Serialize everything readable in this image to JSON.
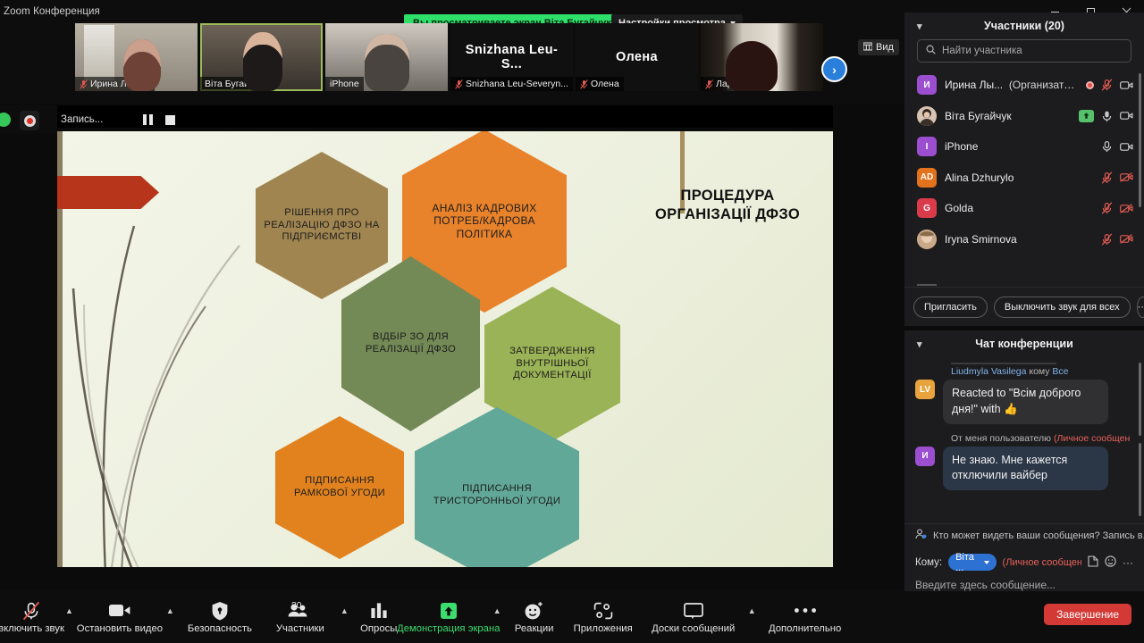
{
  "window": {
    "title": "Zoom Конференция",
    "controls": {
      "minimize": "–",
      "maximize": "❐",
      "close": "✕"
    }
  },
  "share_banner": {
    "notice": "Вы просматриваете экран Віта Бугайчук",
    "view_options": "Настройки просмотра"
  },
  "filmstrip": {
    "view_button": "Вид",
    "next_arrow": "›",
    "tiles": [
      {
        "name": "Ирина Лылык",
        "muted": true,
        "big": "",
        "photo": "ph-irina",
        "speaking": false
      },
      {
        "name": "Віта Бугайчук",
        "muted": false,
        "big": "",
        "photo": "ph-vita",
        "speaking": true
      },
      {
        "name": "iPhone",
        "muted": false,
        "big": "",
        "photo": "ph-iphone",
        "speaking": false
      },
      {
        "name": "Snizhana Leu-Severyn...",
        "muted": true,
        "big": "Snizhana  Leu-S...",
        "photo": "ph-dark",
        "speaking": false
      },
      {
        "name": "Олена",
        "muted": true,
        "big": "Олена",
        "photo": "ph-dark",
        "speaking": false
      },
      {
        "name": "Лариса",
        "muted": true,
        "big": "",
        "photo": "ph-larisa",
        "speaking": false
      }
    ]
  },
  "recording_bar": {
    "label": "Запись...",
    "pause": "pause-icon",
    "stop": "stop-icon"
  },
  "slide": {
    "title": "ПРОЦЕДУРА\nОРГАНІЗАЦІЇ ДФЗО",
    "title_line1": "ПРОЦЕДУРА",
    "title_line2": "ОРГАНІЗАЦІЇ ДФЗО",
    "hexagons": [
      {
        "id": "hex-a",
        "text": "РІШЕННЯ ПРО РЕАЛІЗАЦІЮ ДФЗО НА ПІДПРИЄМСТВІ",
        "color": "#a08550"
      },
      {
        "id": "hex-b",
        "text": "АНАЛІЗ КАДРОВИХ ПОТРЕБ/КАДРОВА ПОЛІТИКА",
        "color": "#e8822b"
      },
      {
        "id": "hex-c",
        "text": "ВІДБІР ЗО ДЛЯ РЕАЛІЗАЦІЇ ДФЗО",
        "color": "#738a56"
      },
      {
        "id": "hex-d",
        "text": "ЗАТВЕРДЖЕННЯ ВНУТРІШНЬОЇ ДОКУМЕНТАЦІЇ",
        "color": "#9ab356"
      },
      {
        "id": "hex-e",
        "text": "ПІДПИСАННЯ РАМКОВОЇ УГОДИ",
        "color": "#e1821f"
      },
      {
        "id": "hex-f",
        "text": "ПІДПИСАННЯ ТРИСТОРОННЬОЇ УГОДИ",
        "color": "#62a898"
      }
    ]
  },
  "participants_panel": {
    "header": "Участники (20)",
    "count": 20,
    "search_placeholder": "Найти участника",
    "rows": [
      {
        "initials": "И",
        "color": "#9b4fd0",
        "name": "Ирина Лы...",
        "role": "(Организатор, я)",
        "recording": true,
        "mic": "mic-off",
        "cam": "cam-on"
      },
      {
        "initials": "",
        "color": "#7a5a48",
        "name": "Віта Бугайчук",
        "role": "",
        "share": true,
        "mic": "mic-on",
        "cam": "cam-on"
      },
      {
        "initials": "I",
        "color": "#9b4fd0",
        "name": "iPhone",
        "role": "",
        "mic": "mic-on",
        "cam": "cam-on"
      },
      {
        "initials": "AD",
        "color": "#e2721c",
        "name": "Alina Dzhurylo",
        "role": "",
        "mic": "mic-off",
        "cam": "cam-off"
      },
      {
        "initials": "G",
        "color": "#d93b4b",
        "name": "Golda",
        "role": "",
        "mic": "mic-off",
        "cam": "cam-off"
      },
      {
        "initials": "",
        "color": "#a07a55",
        "name": "Iryna Smirnova",
        "role": "",
        "mic": "mic-off",
        "cam": "cam-off"
      }
    ],
    "buttons": {
      "invite": "Пригласить",
      "mute_all": "Выключить звук для всех",
      "more": "···"
    }
  },
  "chat_panel": {
    "header": "Чат конференции",
    "messages": [
      {
        "initials": "LV",
        "color": "#e8a33d",
        "sender": "Liudmyla Vasilega",
        "to_label": "кому",
        "to": "Все",
        "private": false,
        "text": "Reacted to \"Всім доброго дня!\" with 👍",
        "style": "gray"
      },
      {
        "initials": "И",
        "color": "#9b4fd0",
        "sender": "От меня пользователю",
        "to_label": "",
        "to": "",
        "private": true,
        "private_label": "(Личное сообщен",
        "text": "Не знаю. Мне кажется отключили вайбер",
        "style": "blue"
      }
    ],
    "privacy_notice": "Кто может видеть ваши сообщения? Запись в...",
    "compose": {
      "to_label": "Кому:",
      "to_value": "Віта ...",
      "private_tag": "(Личное сообщение",
      "placeholder": "Введите здесь сообщение...",
      "file_icon": "file-icon",
      "emoji_icon": "emoji-icon",
      "more_icon": "more-icon"
    }
  },
  "toolbar": {
    "items": [
      {
        "label": "включить звук",
        "icon": "mic-off-icon",
        "caret": true,
        "active": false
      },
      {
        "label": "Остановить видео",
        "icon": "camera-icon",
        "caret": true,
        "active": false
      },
      {
        "label": "Безопасность",
        "icon": "shield-icon",
        "caret": false,
        "active": false
      },
      {
        "label": "Участники",
        "icon": "participants-icon",
        "caret": true,
        "badge": "20",
        "active": false
      },
      {
        "label": "Опросы",
        "icon": "polls-icon",
        "caret": false,
        "active": false
      },
      {
        "label": "Демонстрация экрана",
        "icon": "share-screen-icon",
        "caret": true,
        "active": true
      },
      {
        "label": "Реакции",
        "icon": "reactions-icon",
        "caret": false,
        "active": false
      },
      {
        "label": "Приложения",
        "icon": "apps-icon",
        "caret": false,
        "active": false
      },
      {
        "label": "Доски сообщений",
        "icon": "whiteboard-icon",
        "caret": true,
        "active": false
      },
      {
        "label": "Дополнительно",
        "icon": "more-icon",
        "caret": false,
        "active": false
      }
    ],
    "end_button": "Завершение"
  },
  "colors": {
    "accent_green": "#2ee06a",
    "end_red": "#d33a36",
    "link_blue": "#7fb2e8",
    "private_red": "#e8625a",
    "pill_blue": "#2d72d2"
  }
}
